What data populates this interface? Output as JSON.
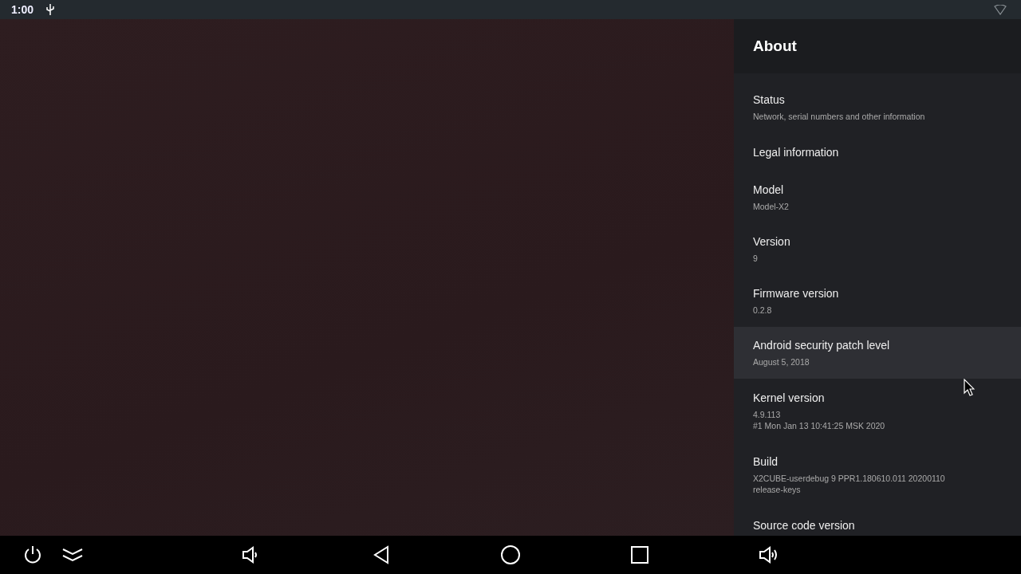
{
  "status_bar": {
    "time": "1:00"
  },
  "panel": {
    "title": "About",
    "items": [
      {
        "title": "Status",
        "lines": [
          "Network, serial numbers and other information"
        ],
        "selected": false
      },
      {
        "title": "Legal information",
        "selected": false
      },
      {
        "title": "Model",
        "lines": [
          "Model-X2"
        ],
        "selected": false
      },
      {
        "title": "Version",
        "lines": [
          "9"
        ],
        "selected": false
      },
      {
        "title": "Firmware version",
        "lines": [
          "0.2.8"
        ],
        "selected": false
      },
      {
        "title": "Android security patch level",
        "lines": [
          "August 5, 2018"
        ],
        "selected": true
      },
      {
        "title": "Kernel version",
        "lines": [
          "4.9.113",
          "#1 Mon Jan 13 10:41:25 MSK 2020"
        ],
        "selected": false
      },
      {
        "title": "Build",
        "lines": [
          "X2CUBE-userdebug 9 PPR1.180610.011 20200110",
          "release-keys"
        ],
        "selected": false
      },
      {
        "title": "Source code version",
        "selected": false
      }
    ]
  }
}
